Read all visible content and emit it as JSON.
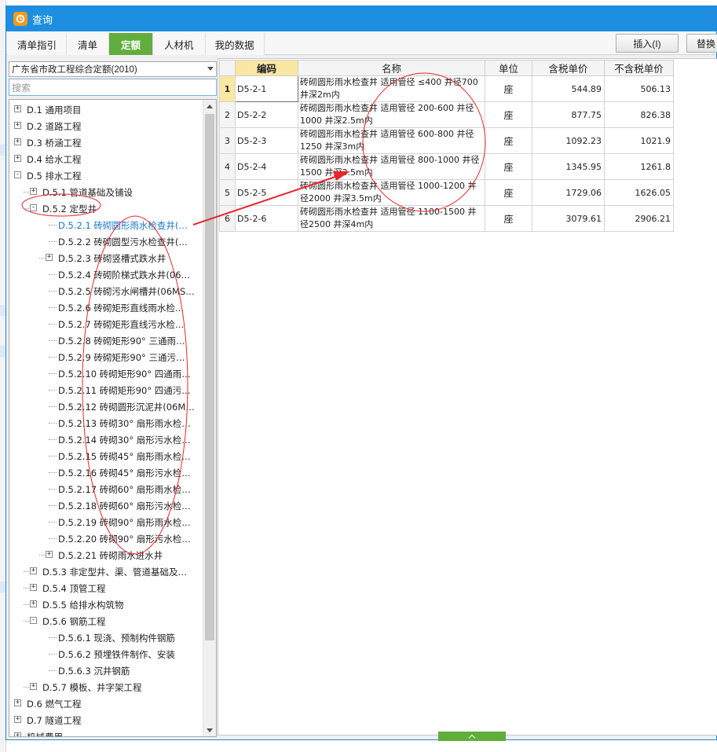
{
  "window": {
    "title": "查询"
  },
  "tabs": [
    {
      "label": "清单指引"
    },
    {
      "label": "清单"
    },
    {
      "label": "定额",
      "active": true
    },
    {
      "label": "人材机"
    },
    {
      "label": "我的数据"
    }
  ],
  "toolbar": {
    "insert_label": "插入(I)",
    "replace_label": "替换"
  },
  "library_select": {
    "value": "广东省市政工程综合定额(2010)"
  },
  "search": {
    "placeholder": "搜索"
  },
  "tree": {
    "items": [
      {
        "label": "D.1 通用项目"
      },
      {
        "label": "D.2 道路工程"
      },
      {
        "label": "D.3 桥涵工程"
      },
      {
        "label": "D.4 给水工程"
      },
      {
        "label": "D.5 排水工程"
      },
      {
        "label": "D.5.1 管道基础及铺设"
      },
      {
        "label": "D.5.2 定型井"
      },
      {
        "label": "D.5.2.1 砖砌圆形雨水检查井(…",
        "selected": true
      },
      {
        "label": "D.5.2.2 砖砌圆型污水检查井(…"
      },
      {
        "label": "D.5.2.3 砖砌竖槽式跌水井"
      },
      {
        "label": "D.5.2.4 砖砌阶梯式跌水井(06…"
      },
      {
        "label": "D.5.2.5 砖砌污水闸槽井(06MS…"
      },
      {
        "label": "D.5.2.6 砖砌矩形直线雨水检…"
      },
      {
        "label": "D.5.2.7 砖砌矩形直线污水检…"
      },
      {
        "label": "D.5.2.8 砖砌矩形90° 三通雨…"
      },
      {
        "label": "D.5.2.9 砖砌矩形90° 三通污…"
      },
      {
        "label": "D.5.2.10 砖砌矩形90° 四通雨…"
      },
      {
        "label": "D.5.2.11 砖砌矩形90° 四通污…"
      },
      {
        "label": "D.5.2.12 砖砌圆形沉泥井(06M…"
      },
      {
        "label": "D.5.2.13 砖砌30° 扇形雨水检…"
      },
      {
        "label": "D.5.2.14 砖砌30° 扇形污水检…"
      },
      {
        "label": "D.5.2.15 砖砌45° 扇形雨水检…"
      },
      {
        "label": "D.5.2.16 砖砌45° 扇形污水检…"
      },
      {
        "label": "D.5.2.17 砖砌60° 扇形雨水检…"
      },
      {
        "label": "D.5.2.18 砖砌60° 扇形污水检…"
      },
      {
        "label": "D.5.2.19 砖砌90° 扇形雨水检…"
      },
      {
        "label": "D.5.2.20 砖砌90° 扇形污水检…"
      },
      {
        "label": "D.5.2.21 砖砌雨水进水井"
      },
      {
        "label": "D.5.3 非定型井、渠、管道基础及…"
      },
      {
        "label": "D.5.4 顶管工程"
      },
      {
        "label": "D.5.5 给排水构筑物"
      },
      {
        "label": "D.5.6 钢筋工程"
      },
      {
        "label": "D.5.6.1 现浇、预制构件钢筋"
      },
      {
        "label": "D.5.6.2 预埋铁件制作、安装"
      },
      {
        "label": "D.5.6.3 沉井钢筋"
      },
      {
        "label": "D.5.7 模板、井字架工程"
      },
      {
        "label": "D.6 燃气工程"
      },
      {
        "label": "D.7 隧道工程"
      },
      {
        "label": "机械费用"
      }
    ]
  },
  "table": {
    "headers": {
      "code": "编码",
      "name": "名称",
      "unit": "单位",
      "price_tax": "含税单价",
      "price_notax": "不含税单价"
    },
    "rows": [
      {
        "idx": "1",
        "code": "D5-2-1",
        "name": "砖砌圆形雨水检查井 适用管径 ≤400 井径700 井深2m内",
        "unit": "座",
        "price_tax": "544.89",
        "price_notax": "506.13"
      },
      {
        "idx": "2",
        "code": "D5-2-2",
        "name": "砖砌圆形雨水检查井 适用管径 200-600 井径1000 井深2.5m内",
        "unit": "座",
        "price_tax": "877.75",
        "price_notax": "826.38"
      },
      {
        "idx": "3",
        "code": "D5-2-3",
        "name": "砖砌圆形雨水检查井 适用管径 600-800 井径1250 井深3m内",
        "unit": "座",
        "price_tax": "1092.23",
        "price_notax": "1021.9"
      },
      {
        "idx": "4",
        "code": "D5-2-4",
        "name": "砖砌圆形雨水检查井 适用管径 800-1000 井径1500 井深3.5m内",
        "unit": "座",
        "price_tax": "1345.95",
        "price_notax": "1261.8"
      },
      {
        "idx": "5",
        "code": "D5-2-5",
        "name": "砖砌圆形雨水检查井 适用管径 1000-1200 井径2000 井深3.5m内",
        "unit": "座",
        "price_tax": "1729.06",
        "price_notax": "1626.05"
      },
      {
        "idx": "6",
        "code": "D5-2-6",
        "name": "砖砌圆形雨水检查井 适用管径 1100-1500 井径2500 井深4m内",
        "unit": "座",
        "price_tax": "3079.61",
        "price_notax": "2906.21"
      }
    ]
  },
  "annotation": {
    "color": "#e8262b"
  }
}
